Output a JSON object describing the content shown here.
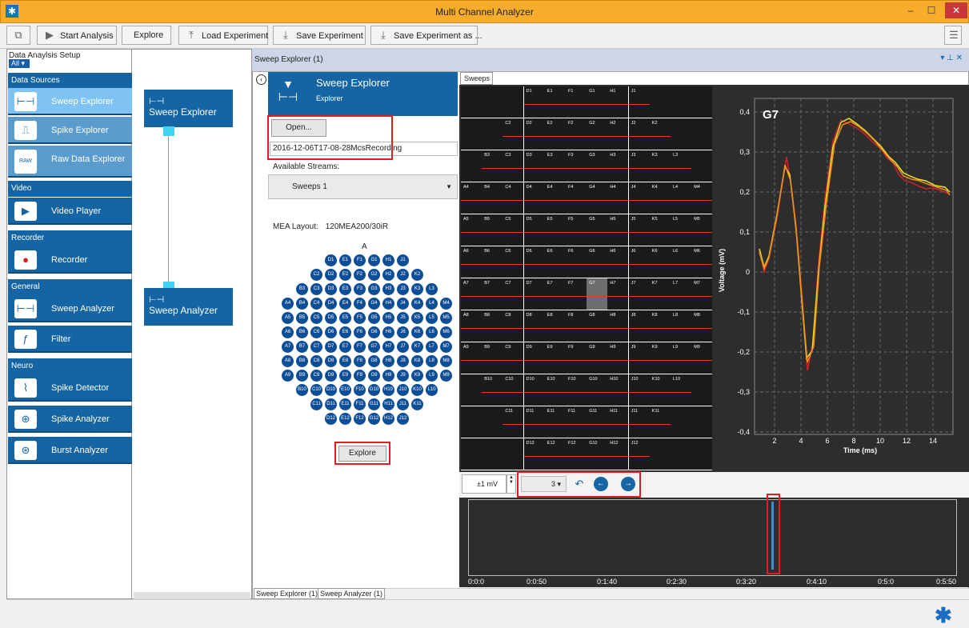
{
  "window": {
    "title": "Multi Channel Analyzer"
  },
  "toolbar": {
    "start_analysis": "Start Analysis",
    "explore": "Explore",
    "load_experiment": "Load Experiment",
    "save_experiment": "Save Experiment",
    "save_experiment_as": "Save Experiment as ..."
  },
  "left_panel": {
    "header": "Data Anaylsis Setup",
    "filter": "All",
    "sections": [
      {
        "title": "Data Sources",
        "items": [
          "Sweep Explorer",
          "Spike Explorer",
          "Raw Data Explorer"
        ]
      },
      {
        "title": "Video",
        "items": [
          "Video Player"
        ]
      },
      {
        "title": "Recorder",
        "items": [
          "Recorder"
        ]
      },
      {
        "title": "General",
        "items": [
          "Sweep Analyzer",
          "Filter"
        ]
      },
      {
        "title": "Neuro",
        "items": [
          "Spike Detector",
          "Spike Analyzer",
          "Burst Analyzer"
        ]
      }
    ],
    "raw_badge": "RAW"
  },
  "pipeline": {
    "nodes": [
      "Sweep Explorer",
      "Sweep Analyzer"
    ]
  },
  "panel": {
    "title": "Sweep Explorer (1)",
    "explorer_title": "Sweep Explorer",
    "explorer_subtitle": "Explorer",
    "open_button": "Open...",
    "recording": "2016-12-06T17-08-28McsRecording",
    "available_streams_label": "Available Streams:",
    "stream": "Sweeps 1",
    "mea_layout_label": "MEA Layout:",
    "mea_layout_value": "120MEA200/30iR",
    "a_label": "A",
    "explore_button": "Explore",
    "sweeps_tab": "Sweeps",
    "mv_range": "±1 mV",
    "sweep_number": "3",
    "bottom_tabs": [
      "Sweep Explorer (1)",
      "Sweep Analyzer (1)"
    ]
  },
  "electrodes": [
    [
      "D1",
      "E1",
      "F1",
      "G1",
      "H1",
      "J1"
    ],
    [
      "C2",
      "D2",
      "E2",
      "F2",
      "G2",
      "H2",
      "J2",
      "K2"
    ],
    [
      "B3",
      "C3",
      "D3",
      "E3",
      "F3",
      "G3",
      "H3",
      "J3",
      "K3",
      "L3"
    ],
    [
      "A4",
      "B4",
      "C4",
      "D4",
      "E4",
      "F4",
      "G4",
      "H4",
      "J4",
      "K4",
      "L4",
      "M4"
    ],
    [
      "A5",
      "B5",
      "C5",
      "D5",
      "E5",
      "F5",
      "G5",
      "H5",
      "J5",
      "K5",
      "L5",
      "M5"
    ],
    [
      "A6",
      "B6",
      "C6",
      "D6",
      "E6",
      "F6",
      "G6",
      "H6",
      "J6",
      "K6",
      "L6",
      "M6"
    ],
    [
      "A7",
      "B7",
      "C7",
      "D7",
      "E7",
      "F7",
      "G7",
      "H7",
      "J7",
      "K7",
      "L7",
      "M7"
    ],
    [
      "A8",
      "B8",
      "C8",
      "D8",
      "E8",
      "F8",
      "G8",
      "H8",
      "J8",
      "K8",
      "L8",
      "M8"
    ],
    [
      "A9",
      "B9",
      "C9",
      "D9",
      "E9",
      "F9",
      "G9",
      "H9",
      "J9",
      "K9",
      "L9",
      "M9"
    ],
    [
      "B10",
      "C10",
      "D10",
      "E10",
      "F10",
      "G10",
      "H10",
      "J10",
      "K10",
      "L10"
    ],
    [
      "C11",
      "D11",
      "E11",
      "F11",
      "G11",
      "H11",
      "J11",
      "K11"
    ],
    [
      "D12",
      "E12",
      "F12",
      "G12",
      "H12",
      "J12"
    ]
  ],
  "selected_channel": "G7",
  "plot": {
    "xlabel": "Time (ms)",
    "ylabel": "Voltage (mV)",
    "yticks": [
      "0,4",
      "0,3",
      "0,2",
      "0,1",
      "0",
      "-0,1",
      "-0,2",
      "-0,3",
      "-0,4"
    ],
    "xticks": [
      "2",
      "4",
      "6",
      "8",
      "10",
      "12",
      "14"
    ]
  },
  "timeline": {
    "ticks": [
      "0:0:0",
      "0:0:50",
      "0:1:40",
      "0:2:30",
      "0:3:20",
      "0:4:10",
      "0:5:0",
      "0:5:50"
    ]
  }
}
